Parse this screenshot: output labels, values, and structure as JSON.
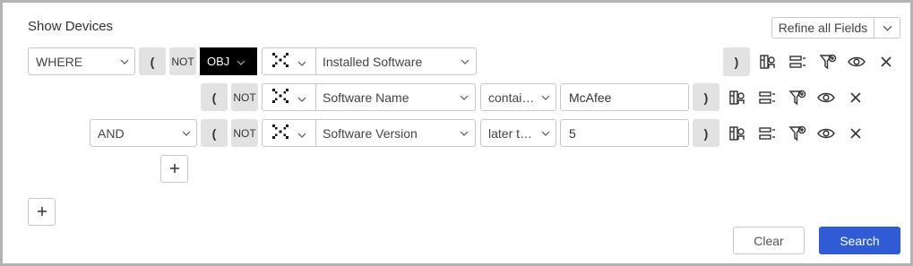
{
  "title": "Show Devices",
  "refine": {
    "label": "Refine all Fields"
  },
  "rows": [
    {
      "logic": "WHERE",
      "open_paren": "(",
      "not": "NOT",
      "obj": "OBJ",
      "field": "Installed Software",
      "close_paren": ")"
    },
    {
      "open_paren": "(",
      "not": "NOT",
      "field": "Software Name",
      "operator": "contai…",
      "value": "McAfee",
      "close_paren": ")"
    },
    {
      "logic": "AND",
      "open_paren": "(",
      "not": "NOT",
      "field": "Software Version",
      "operator": "later t…",
      "value": "5",
      "close_paren": ")"
    }
  ],
  "buttons": {
    "clear": "Clear",
    "search": "Search"
  },
  "colors": {
    "primary": "#2f5bd3",
    "obj_bg": "#000000",
    "paren_bg": "#e2e2e2"
  },
  "icons": [
    "chevron-down-icon",
    "adapter-x-icon",
    "field-filter-icon",
    "duplicate-row-icon",
    "add-filter-icon",
    "eye-icon",
    "close-icon",
    "plus-icon"
  ]
}
